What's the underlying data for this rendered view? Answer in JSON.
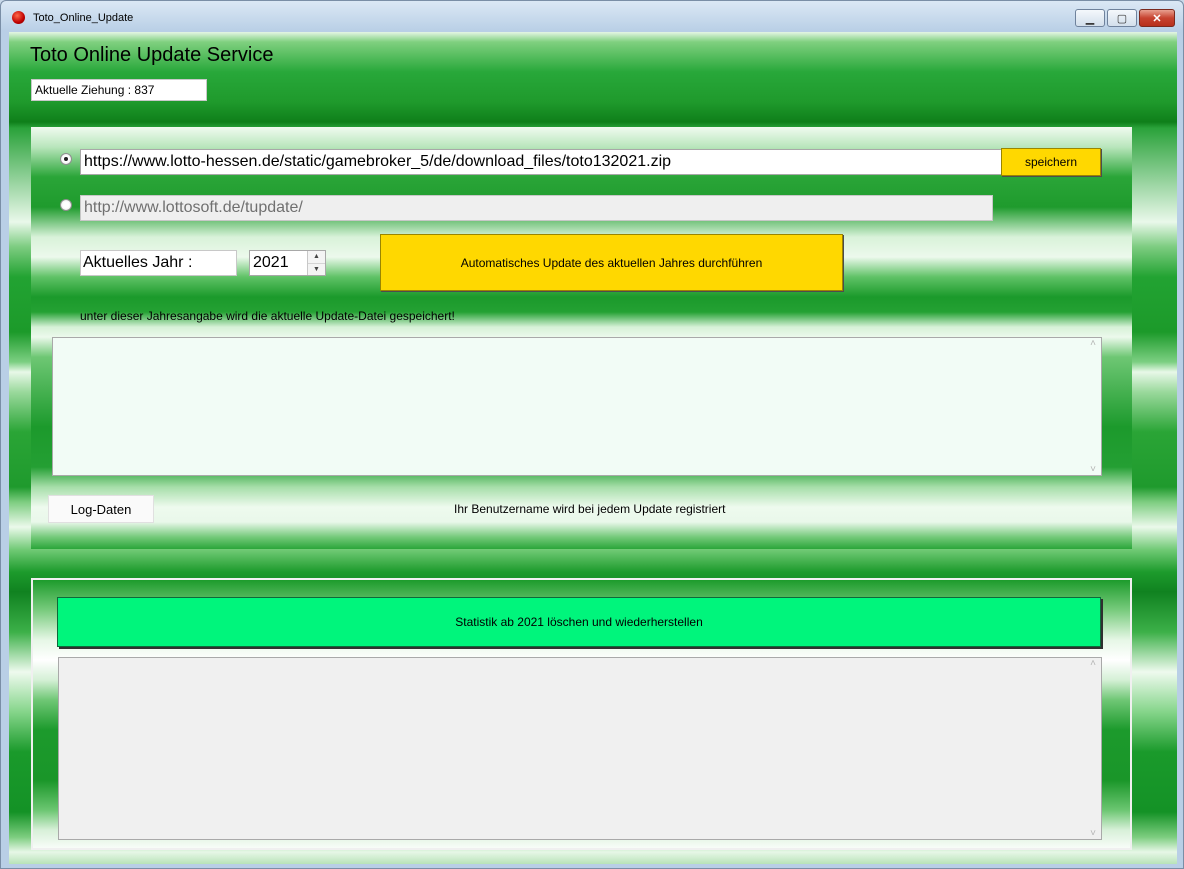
{
  "window": {
    "title": "Toto_Online_Update",
    "minimize_glyph": "▁",
    "maximize_glyph": "▢",
    "close_glyph": "✕"
  },
  "header": {
    "title": "Toto Online Update Service",
    "draw_info": "Aktuelle Ziehung : 837"
  },
  "sources": {
    "primary_url": "https://www.lotto-hessen.de/static/gamebroker_5/de/download_files/toto132021.zip",
    "primary_selected": true,
    "secondary_url": "http://www.lottosoft.de/tupdate/",
    "secondary_selected": false,
    "save_label": "speichern"
  },
  "year": {
    "label": "Aktuelles Jahr :",
    "value": "2021",
    "spin_up": "▲",
    "spin_down": "▼",
    "auto_update_label": "Automatisches Update des aktuellen Jahres durchführen",
    "hint": "unter dieser Jahresangabe wird die aktuelle Update-Datei gespeichert!"
  },
  "log": {
    "button_label": "Log-Daten",
    "notice": "Ihr Benutzername wird bei jedem Update registriert",
    "scroll_up": "˄",
    "scroll_down": "˅"
  },
  "stats": {
    "button_label": "Statistik ab 2021 löschen und wiederherstellen"
  }
}
